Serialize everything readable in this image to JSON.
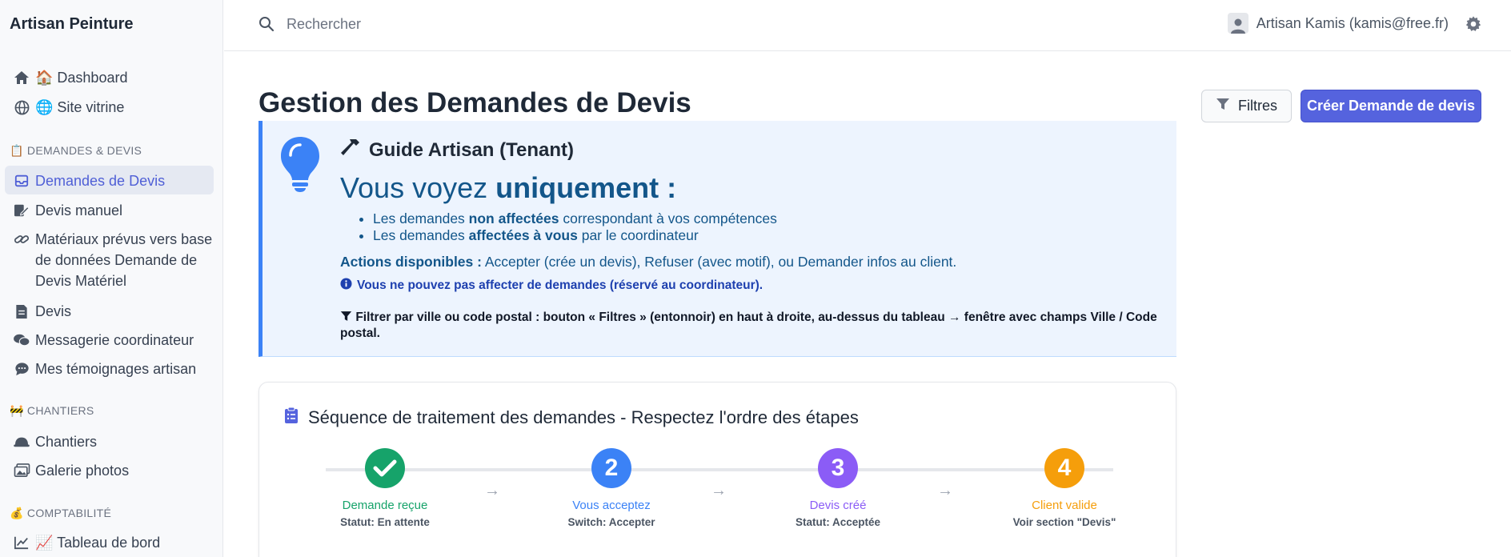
{
  "brand": "Artisan Peinture",
  "search": {
    "placeholder": "Rechercher"
  },
  "user": {
    "name": "Artisan Kamis (kamis@free.fr)"
  },
  "sidebar": {
    "items_top": [
      {
        "label": "🏠 Dashboard",
        "icon": "home-icon"
      },
      {
        "label": "🌐 Site vitrine",
        "icon": "globe-icon"
      }
    ],
    "section_demandes": "📋 DEMANDES & DEVIS",
    "items_demandes": [
      {
        "label": "Demandes de Devis",
        "icon": "inbox-icon",
        "active": true
      },
      {
        "label": "Devis manuel",
        "icon": "edit-document-icon"
      },
      {
        "label": "Matériaux prévus vers base de données Demande de Devis Matériel",
        "icon": "link-icon"
      },
      {
        "label": "Devis",
        "icon": "invoice-icon"
      },
      {
        "label": "Messagerie coordinateur",
        "icon": "chat-icon"
      },
      {
        "label": "Mes témoignages artisan",
        "icon": "comment-icon"
      }
    ],
    "section_chantiers": "🚧 CHANTIERS",
    "items_chantiers": [
      {
        "label": "Chantiers",
        "icon": "hard-hat-icon"
      },
      {
        "label": "Galerie photos",
        "icon": "images-icon"
      }
    ],
    "section_compta": "💰 COMPTABILITÉ",
    "items_compta": [
      {
        "label": "📈 Tableau de bord",
        "icon": "chart-line-icon"
      }
    ]
  },
  "page": {
    "title": "Gestion des Demandes de Devis",
    "filter_button": "Filtres",
    "create_button": "Créer Demande de devis"
  },
  "guide": {
    "title": "Guide Artisan (Tenant)",
    "head_lite": "Vous voyez ",
    "head_bold": "uniquement :",
    "bullet1_a": "Les demandes ",
    "bullet1_b": "non affectées",
    "bullet1_c": " correspondant à vos compétences",
    "bullet2_a": "Les demandes ",
    "bullet2_b": "affectées à vous",
    "bullet2_c": " par le coordinateur",
    "actions_label": "Actions disponibles :",
    "actions_text": " Accepter (crée un devis), Refuser (avec motif), ou Demander infos au client.",
    "info": "Vous ne pouvez pas affecter de demandes (réservé au coordinateur).",
    "filter_label": "Filtrer par ville ou code postal :",
    "filter_text_1": " bouton « ",
    "filter_text_2": "Filtres",
    "filter_text_3": " » (entonnoir) ",
    "filter_text_4": "en haut à droite",
    "filter_text_5": ", au-dessus du tableau → fenêtre avec champs Ville / Code postal."
  },
  "sequence": {
    "title": "Séquence de traitement des demandes - Respectez l'ordre des étapes",
    "arrow": "→",
    "steps": [
      {
        "marker": "✓",
        "label": "Demande reçue",
        "status": "Statut: En attente",
        "color": "#16a36a"
      },
      {
        "marker": "2",
        "label": "Vous acceptez",
        "status": "Switch: Accepter",
        "color": "#3b82f6"
      },
      {
        "marker": "3",
        "label": "Devis créé",
        "status": "Statut: Acceptée",
        "color": "#8b5cf6"
      },
      {
        "marker": "4",
        "label": "Client valide",
        "status": "Voir section \"Devis\"",
        "color": "#f59e0b"
      }
    ]
  }
}
